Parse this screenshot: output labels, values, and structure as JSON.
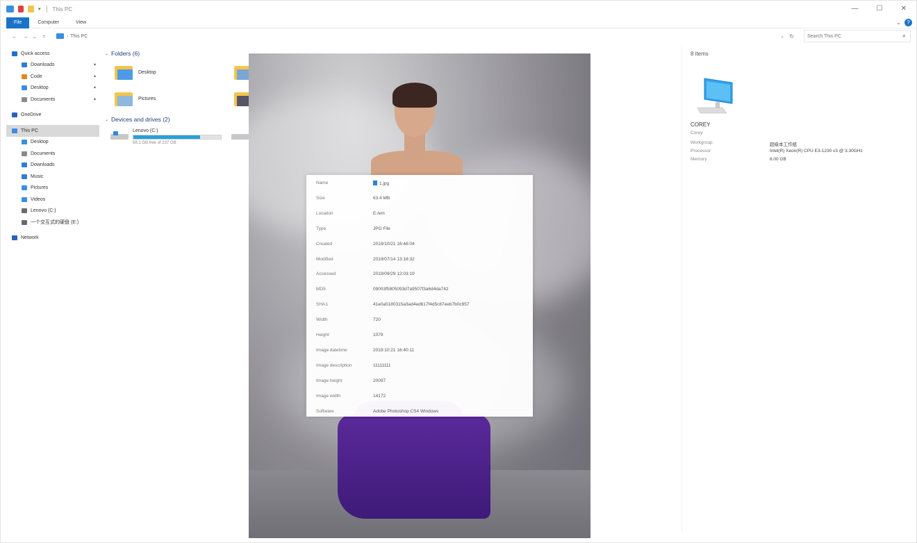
{
  "window": {
    "title": "This PC",
    "controls": {
      "minimize": "—",
      "maximize": "☐",
      "close": "✕"
    }
  },
  "ribbon": {
    "tabs": [
      "File",
      "Computer",
      "View"
    ],
    "help": "?"
  },
  "address": {
    "path": "This PC",
    "search_placeholder": "Search This PC"
  },
  "sidebar": {
    "items": [
      {
        "label": "Quick access",
        "color": "#1a73c9",
        "pinned": false,
        "indent": 0
      },
      {
        "label": "Downloads",
        "color": "#2f7fd1",
        "pinned": true,
        "indent": 1
      },
      {
        "label": "Code",
        "color": "#e08a1e",
        "pinned": true,
        "indent": 1
      },
      {
        "label": "Desktop",
        "color": "#3a8ee0",
        "pinned": true,
        "indent": 1
      },
      {
        "label": "Documents",
        "color": "#8a8a8a",
        "pinned": true,
        "indent": 1
      },
      {
        "label": "OneDrive",
        "color": "#2a63b8",
        "pinned": false,
        "indent": 0
      },
      {
        "label": "This PC",
        "color": "#3a8ee0",
        "pinned": false,
        "indent": 0,
        "selected": true
      },
      {
        "label": "Desktop",
        "color": "#3a8ee0",
        "pinned": false,
        "indent": 1
      },
      {
        "label": "Documents",
        "color": "#8a8a8a",
        "pinned": false,
        "indent": 1
      },
      {
        "label": "Downloads",
        "color": "#2f7fd1",
        "pinned": false,
        "indent": 1
      },
      {
        "label": "Music",
        "color": "#2f7fd1",
        "pinned": false,
        "indent": 1
      },
      {
        "label": "Pictures",
        "color": "#3a8ee0",
        "pinned": false,
        "indent": 1
      },
      {
        "label": "Videos",
        "color": "#3a8ee0",
        "pinned": false,
        "indent": 1
      },
      {
        "label": "Lenovo (C:)",
        "color": "#6a6a6a",
        "pinned": false,
        "indent": 1
      },
      {
        "label": "一个交互式的硬盘 (E:)",
        "color": "#6a6a6a",
        "pinned": false,
        "indent": 1
      },
      {
        "label": "Network",
        "color": "#2a63b8",
        "pinned": false,
        "indent": 0
      }
    ]
  },
  "content": {
    "folders_header": "Folders (6)",
    "folders": [
      "Desktop",
      "Pictures"
    ],
    "drives_header": "Devices and drives (2)",
    "drives": [
      {
        "name": "Lenovo (C:)",
        "free": "56.1 GB free of 237 GB",
        "used_fraction": 0.76
      }
    ]
  },
  "details": {
    "count": "8 items",
    "pc_name": "COREY",
    "pc_sub": "Corey",
    "rows": [
      {
        "label": "Workgroup",
        "value": "超级本工作组"
      },
      {
        "label": "Processor",
        "value": "Intel(R) Xeon(R) CPU E3-1230 v3 @ 3.30GHz"
      },
      {
        "label": "Memory",
        "value": "8.00 GB"
      }
    ]
  },
  "properties": {
    "rows": [
      {
        "label": "Name",
        "value": "1.jpg"
      },
      {
        "label": "Size",
        "value": "63.4 MB"
      },
      {
        "label": "Location",
        "value": "E:/em"
      },
      {
        "label": "Type",
        "value": "JPG File"
      },
      {
        "label": "Created",
        "value": "2019/10/21 16:46:04"
      },
      {
        "label": "Modified",
        "value": "2019/07/14 13:18:32"
      },
      {
        "label": "Accessed",
        "value": "2019/09/29 12:03:19"
      },
      {
        "label": "MD5",
        "value": "09003f5805093d7a9507f3a6d4da742"
      },
      {
        "label": "SHA1",
        "value": "41e0a5180315a3ad4ed617f4d5c87eeb7b0c957"
      },
      {
        "label": "Width",
        "value": "720"
      },
      {
        "label": "Height",
        "value": "1079"
      },
      {
        "label": "Image datetime",
        "value": "2019:10:21 16:40:11"
      },
      {
        "label": "Image description",
        "value": "11111111"
      },
      {
        "label": "Image height",
        "value": "20097"
      },
      {
        "label": "Image width",
        "value": "14172"
      },
      {
        "label": "Software",
        "value": "Adobe Photoshop CS4 Windows"
      }
    ]
  }
}
